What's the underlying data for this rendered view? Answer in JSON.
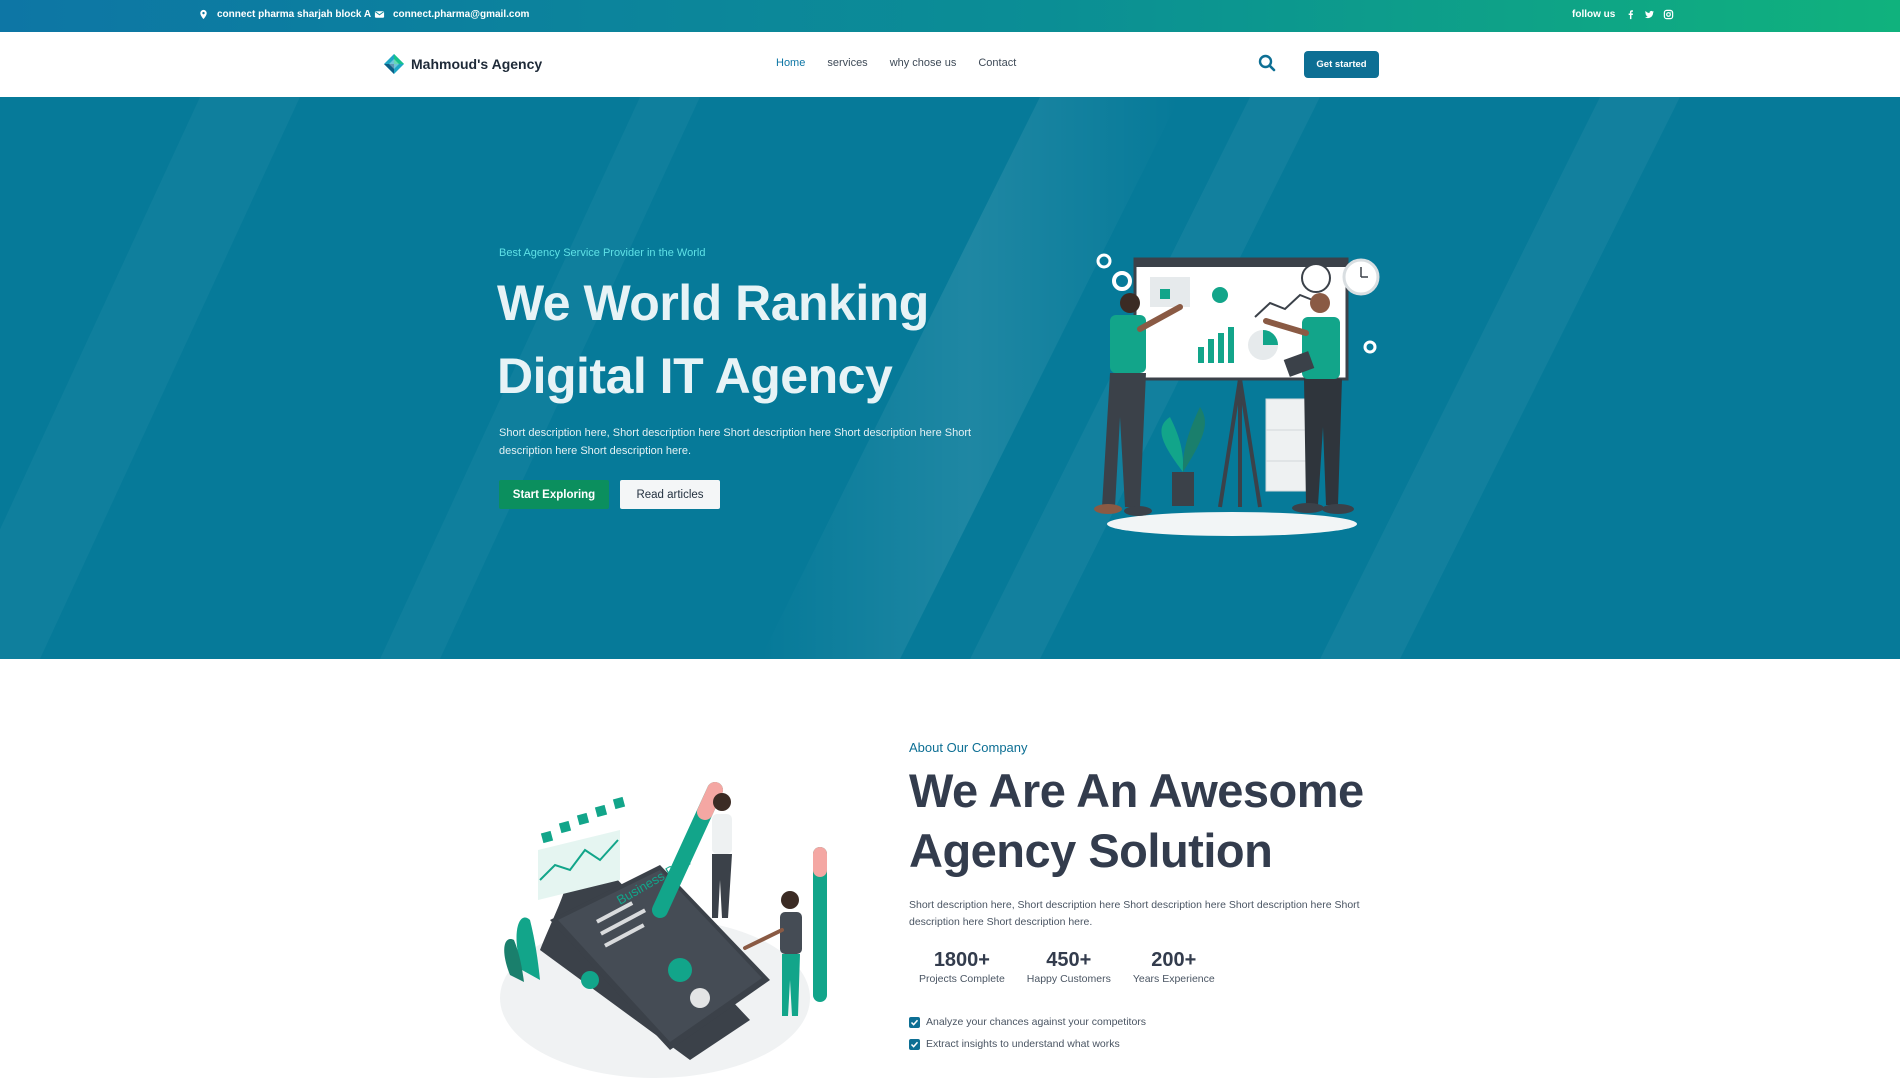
{
  "topbar": {
    "address": "connect pharma sharjah block A",
    "email": "connect.pharma@gmail.com",
    "follow_label": "follow us",
    "socials": [
      "facebook-icon",
      "twitter-icon",
      "instagram-icon"
    ]
  },
  "header": {
    "brand": "Mahmoud's Agency",
    "nav": [
      {
        "label": "Home",
        "active": true
      },
      {
        "label": "services",
        "active": false
      },
      {
        "label": "why chose us",
        "active": false
      },
      {
        "label": "Contact",
        "active": false
      }
    ],
    "cta": "Get started"
  },
  "hero": {
    "tagline": "Best Agency Service Provider in the World",
    "title_line1": "We World Ranking",
    "title_line2": "Digital IT Agency",
    "description": "Short description here, Short description here Short description here Short description here Short description here Short description here.",
    "primary_button": "Start Exploring",
    "secondary_button": "Read articles"
  },
  "about": {
    "eyebrow": "About Our Company",
    "title_line1": "We Are An Awesome",
    "title_line2": "Agency Solution",
    "description": "Short description here, Short description here Short description here Short description here Short description here Short description here.",
    "stats": [
      {
        "value": "1800+",
        "label": "Projects Complete"
      },
      {
        "value": "450+",
        "label": "Happy Customers"
      },
      {
        "value": "200+",
        "label": "Years Experience"
      }
    ],
    "checks": [
      "Analyze your chances against your competitors",
      "Extract insights to understand what works"
    ],
    "illustration_text": "Business Plan"
  },
  "colors": {
    "topbar_start": "#0d76a5",
    "topbar_end": "#10b27d",
    "hero_bg": "#067a99",
    "accent": "#0d6f94",
    "green": "#0b8f5e"
  }
}
